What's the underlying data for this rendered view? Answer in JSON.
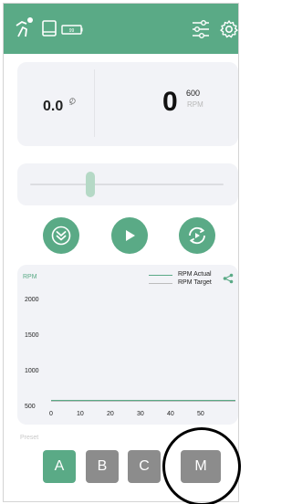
{
  "colors": {
    "accent": "#5aaa86",
    "card_bg": "#f2f3f7",
    "preset_inactive": "#8c8c8c",
    "target_series": "#bdbdbd"
  },
  "topbar": {
    "icons": [
      "run-icon",
      "tablet-icon",
      "battery-icon",
      "settings-sliders-icon",
      "gear-icon"
    ],
    "battery_text": "99"
  },
  "status": {
    "time_value": "0.0",
    "time_unit": "s",
    "rpm_value": "0",
    "rpm_max": "600",
    "rpm_unit": "RPM"
  },
  "speed_slider": {
    "level": 0.31
  },
  "controls": {
    "icons": [
      "ramp-down-icon",
      "play-icon",
      "cycle-icon"
    ]
  },
  "chart_data": {
    "type": "line",
    "ylabel": "RPM",
    "y_ticks": [
      "2000",
      "1500",
      "1000",
      "500"
    ],
    "x_ticks": [
      "0",
      "10",
      "20",
      "30",
      "40",
      "50"
    ],
    "xlim": [
      0,
      60
    ],
    "ylim": [
      500,
      2000
    ],
    "series": [
      {
        "name": "RPM Actual",
        "color": "#5aaa86",
        "x": [
          0,
          60
        ],
        "values": [
          600,
          600
        ]
      },
      {
        "name": "RPM Target",
        "color": "#bdbdbd",
        "x": [
          0,
          60
        ],
        "values": [
          600,
          600
        ]
      }
    ],
    "legend_position": "top-right",
    "share_icon": "share-icon"
  },
  "presets": {
    "label": "Preset",
    "items": [
      {
        "label": "A",
        "active": true
      },
      {
        "label": "B",
        "active": false
      },
      {
        "label": "C",
        "active": false
      },
      {
        "label": "M",
        "active": false
      }
    ]
  }
}
